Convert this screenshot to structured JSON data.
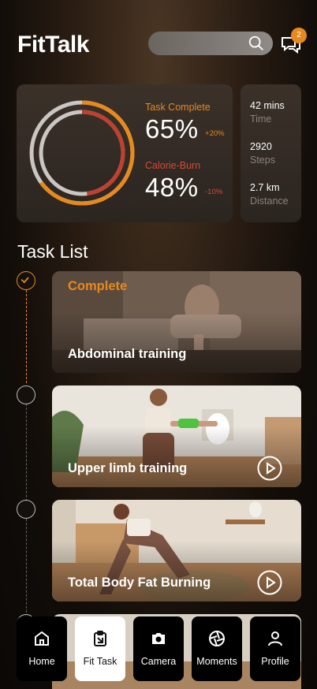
{
  "app": {
    "brand": "FitTalk"
  },
  "header": {
    "search": {
      "placeholder": "",
      "value": ""
    },
    "notification_count": "2"
  },
  "stats": {
    "task_complete": {
      "label": "Task Complete",
      "value": "65%",
      "delta": "+20%",
      "fraction": 0.65
    },
    "calorie_burn": {
      "label": "Calorie-Burn",
      "value": "48%",
      "delta": "-10%",
      "fraction": 0.48
    }
  },
  "side_stats": [
    {
      "value": "42 mins",
      "label": "Time"
    },
    {
      "value": "2920",
      "label": "Steps"
    },
    {
      "value": "2.7 km",
      "label": "Distance"
    }
  ],
  "task_list": {
    "title": "Task List",
    "items": [
      {
        "status": "Complete",
        "title": "Abdominal training",
        "done": true
      },
      {
        "status": "",
        "title": "Upper limb training",
        "done": false
      },
      {
        "status": "",
        "title": "Total Body Fat Burning",
        "done": false
      }
    ]
  },
  "tabs": [
    {
      "label": "Home",
      "icon": "home-icon",
      "active": false
    },
    {
      "label": "Fit Task",
      "icon": "clipboard-icon",
      "active": true
    },
    {
      "label": "Camera",
      "icon": "camera-icon",
      "active": false
    },
    {
      "label": "Moments",
      "icon": "aperture-icon",
      "active": false
    },
    {
      "label": "Profile",
      "icon": "user-icon",
      "active": false
    }
  ],
  "colors": {
    "accent": "#e8891d",
    "calorie": "#d44a3a",
    "ring_track": "#c9c6c3"
  }
}
